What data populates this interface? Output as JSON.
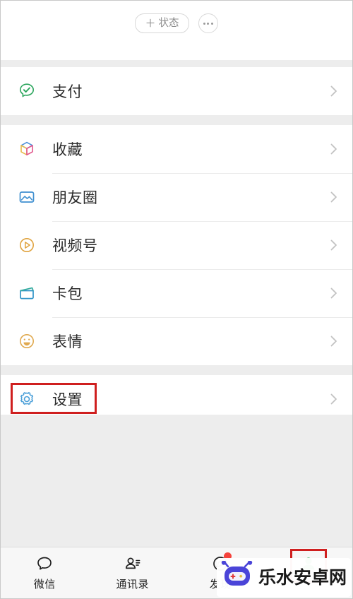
{
  "header": {
    "status_button": {
      "label": "状态",
      "plus": "＋",
      "icon": "plus-icon"
    },
    "more_button": {
      "icon": "more-dots-icon"
    }
  },
  "menu_groups": [
    {
      "name": "pay-group",
      "items": [
        {
          "label": "支付",
          "icon": "wechat-pay-icon",
          "color": "#2ba55c",
          "chevron": "chevron-right-icon"
        }
      ]
    },
    {
      "name": "services-group",
      "items": [
        {
          "label": "收藏",
          "icon": "favorites-cube-icon",
          "color": "#4a90d9",
          "chevron": "chevron-right-icon"
        },
        {
          "label": "朋友圈",
          "icon": "moments-photo-icon",
          "color": "#3f8fd0",
          "chevron": "chevron-right-icon"
        },
        {
          "label": "视频号",
          "icon": "channels-play-icon",
          "color": "#e2a martin",
          "chevron": "chevron-right-icon"
        },
        {
          "label": "卡包",
          "icon": "cards-wallet-icon",
          "color": "#39a0c4",
          "chevron": "chevron-right-icon"
        },
        {
          "label": "表情",
          "icon": "stickers-smiley-icon",
          "color": "#e0a94f",
          "chevron": "chevron-right-icon"
        }
      ]
    },
    {
      "name": "settings-group",
      "items": [
        {
          "label": "设置",
          "icon": "settings-gear-icon",
          "color": "#4a9fd8",
          "chevron": "chevron-right-icon",
          "annotated": true
        }
      ]
    }
  ],
  "tabbar": {
    "tabs": [
      {
        "label": "微信",
        "icon": "chat-bubble-icon",
        "active": false,
        "badge": false
      },
      {
        "label": "通讯录",
        "icon": "contacts-person-icon",
        "active": false,
        "badge": false
      },
      {
        "label": "发现",
        "icon": "discover-compass-icon",
        "active": false,
        "badge": true
      },
      {
        "label": "",
        "icon": "me-person-icon",
        "active": true,
        "badge": false,
        "annotated": true
      }
    ]
  },
  "watermark": {
    "text": "乐水安卓网",
    "icon": "robot-mascot-icon",
    "body_color": "#4a44d8",
    "accent_red": "#e0383b",
    "accent_yellow": "#e8b93a"
  },
  "colors": {
    "page_background": "#ededed",
    "card_background": "#ffffff",
    "divider": "#ebebeb",
    "text_primary": "#2b2b2b",
    "text_muted": "#8c8c8c",
    "annotation_red": "#cf1f1f",
    "active_green": "#3eb575",
    "badge_red": "#f5433c"
  }
}
